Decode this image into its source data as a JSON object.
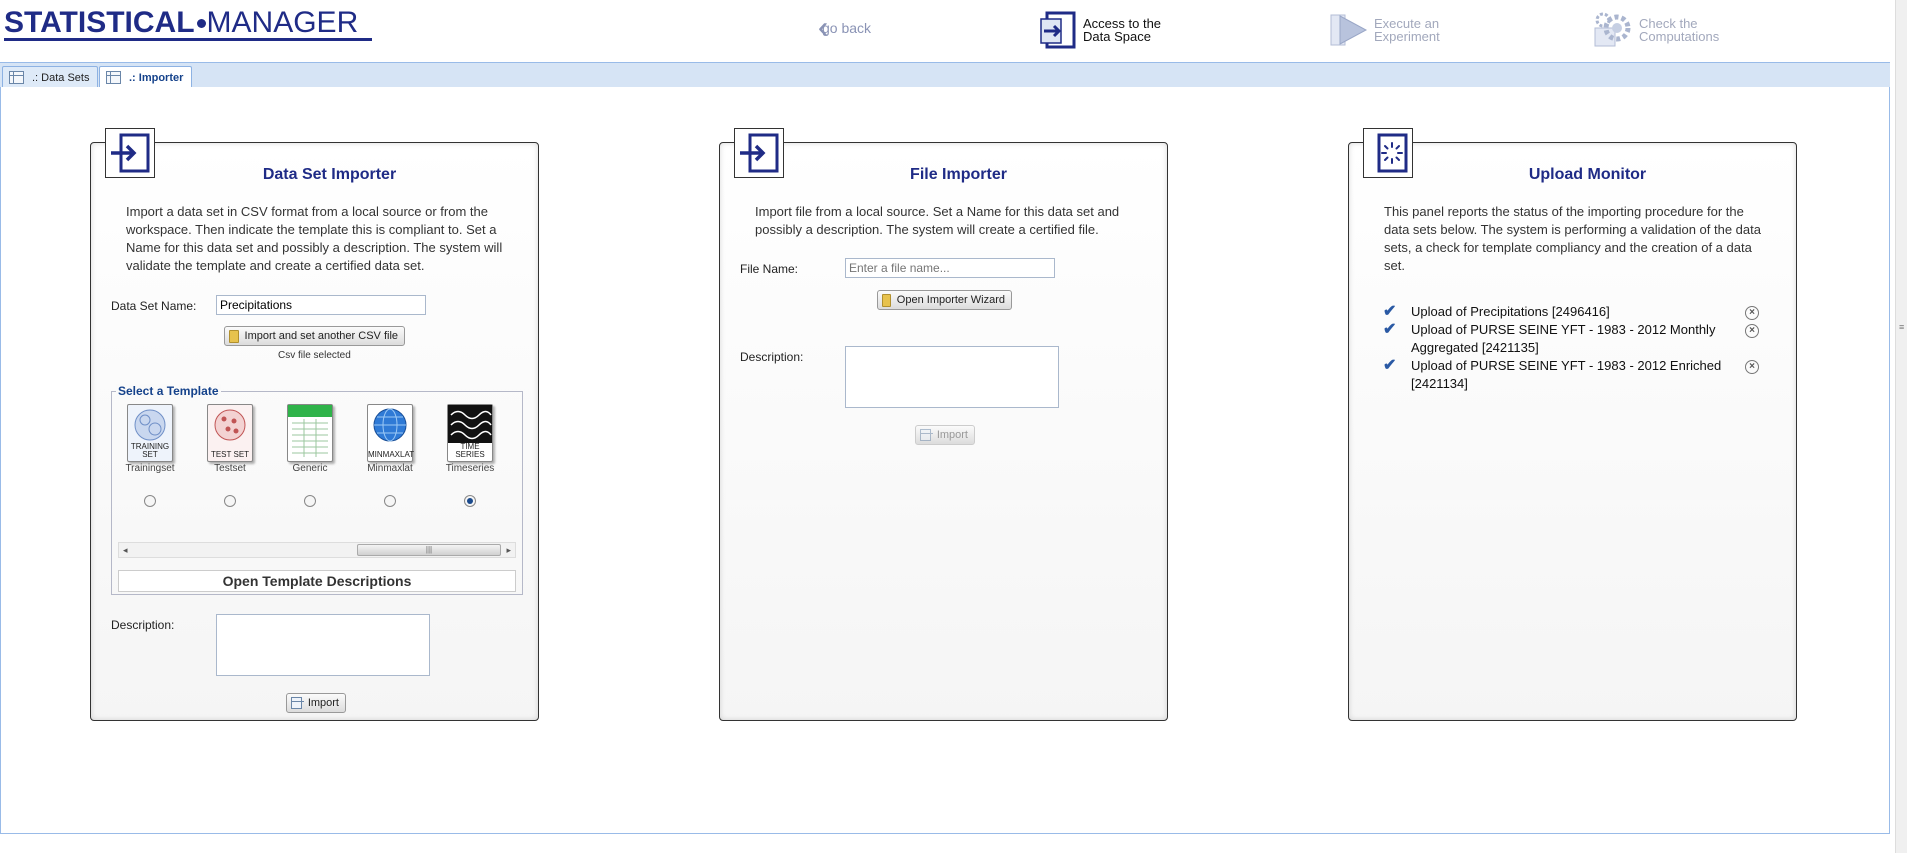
{
  "header": {
    "logo_part1": "STATISTICAL",
    "logo_part2": "MANAGER",
    "nav": {
      "back_label": "go back",
      "access_line1": "Access to the",
      "access_line2": "Data Space",
      "exec_line1": "Execute an",
      "exec_line2": "Experiment",
      "check_line1": "Check the",
      "check_line2": "Computations"
    }
  },
  "tabs": [
    {
      "label": ".: Data Sets",
      "active": false
    },
    {
      "label": ".: Importer",
      "active": true
    }
  ],
  "dataset_importer": {
    "title": "Data Set Importer",
    "description": "Import a data set in CSV format from a local source or from the workspace. Then indicate the template this is compliant to. Set a Name for this data set and possibly a description. The system will validate the template and create a certified data set.",
    "name_label": "Data Set Name:",
    "name_value": "Precipitations",
    "csv_button": "Import and set another CSV file",
    "csv_status": "Csv file selected",
    "template_legend": "Select a Template",
    "templates": [
      {
        "caption": "TRAINING SET",
        "name": "Trainingset",
        "selected": false
      },
      {
        "caption": "TEST SET",
        "name": "Testset",
        "selected": false
      },
      {
        "caption": "",
        "name": "Generic",
        "selected": false
      },
      {
        "caption": "MINMAXLAT",
        "name": "Minmaxlat",
        "selected": false
      },
      {
        "caption": "TIME SERIES",
        "name": "Timeseries",
        "selected": true
      }
    ],
    "open_descriptions": "Open Template Descriptions",
    "description_label": "Description:",
    "import_button": "Import"
  },
  "file_importer": {
    "title": "File Importer",
    "description": "Import file from a local source. Set a Name for this data set and possibly a description. The system will create a certified file.",
    "name_label": "File Name:",
    "name_placeholder": "Enter a file name...",
    "wizard_button": "Open Importer Wizard",
    "description_label": "Description:",
    "import_button": "Import"
  },
  "upload_monitor": {
    "title": "Upload Monitor",
    "description": "This panel reports the status of the importing procedure for the data sets below. The system is performing a validation of the data sets, a check for template compliancy and the creation of a data set.",
    "items": [
      {
        "text": "Upload of Precipitations [2496416]"
      },
      {
        "text": "Upload of PURSE SEINE YFT - 1983 - 2012 Monthly Aggregated [2421135]"
      },
      {
        "text": "Upload of PURSE SEINE YFT - 1983 - 2012 Enriched [2421134]"
      }
    ]
  },
  "colors": {
    "brand": "#1f2b86",
    "tab_bar": "#d6e4f5",
    "check": "#2a59a4"
  }
}
